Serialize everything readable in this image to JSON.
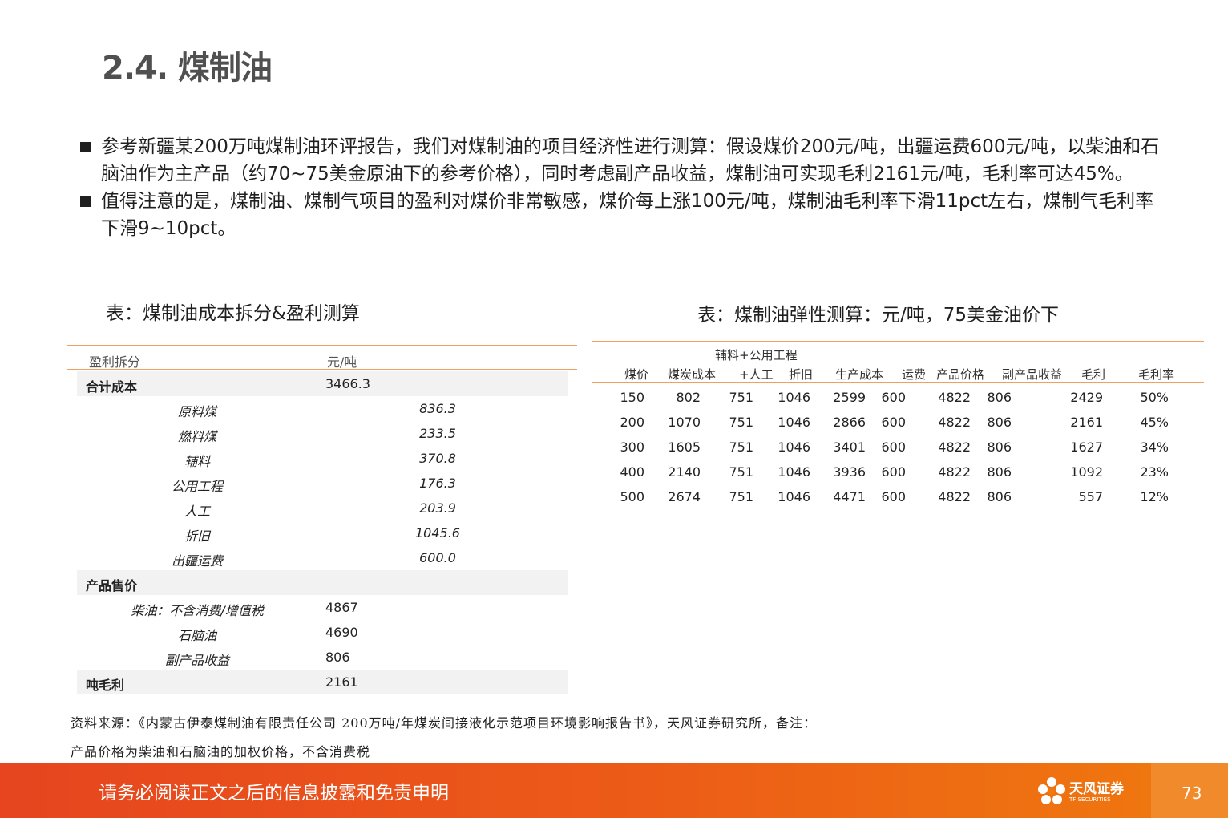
{
  "title": "2.4. 煤制油",
  "bullets": [
    "参考新疆某200万吨煤制油环评报告，我们对煤制油的项目经济性进行测算：假设煤价200元/吨，出疆运费600元/吨，以柴油和石脑油作为主产品（约70~75美金原油下的参考价格），同时考虑副产品收益，煤制油可实现毛利2161元/吨，毛利率可达45%。",
    "值得注意的是，煤制油、煤制气项目的盈利对煤价非常敏感，煤价每上涨100元/吨，煤制油毛利率下滑11pct左右，煤制气毛利率下滑9~10pct。"
  ],
  "left_table": {
    "caption": "表：煤制油成本拆分&盈利测算",
    "header": [
      "盈利拆分",
      "元/吨"
    ],
    "rows": [
      {
        "label": "合计成本",
        "value": "3466.3",
        "type": "section"
      },
      {
        "label": "原料煤",
        "value": "836.3",
        "type": "sub"
      },
      {
        "label": "燃料煤",
        "value": "233.5",
        "type": "sub"
      },
      {
        "label": "辅料",
        "value": "370.8",
        "type": "sub"
      },
      {
        "label": "公用工程",
        "value": "176.3",
        "type": "sub"
      },
      {
        "label": "人工",
        "value": "203.9",
        "type": "sub"
      },
      {
        "label": "折旧",
        "value": "1045.6",
        "type": "sub"
      },
      {
        "label": "出疆运费",
        "value": "600.0",
        "type": "sub"
      },
      {
        "label": "产品售价",
        "value": "",
        "type": "section"
      },
      {
        "label": "柴油：不含消费/增值税",
        "value": "4867",
        "type": "sub2"
      },
      {
        "label": "石脑油",
        "value": "4690",
        "type": "sub2"
      },
      {
        "label": "副产品收益",
        "value": "806",
        "type": "sub2"
      },
      {
        "label": "吨毛利",
        "value": "2161",
        "type": "section"
      }
    ]
  },
  "right_table": {
    "caption": "表：煤制油弹性测算：元/吨，75美金油价下",
    "header_top": "辅料+公用工程",
    "header": [
      "煤价",
      "煤炭成本",
      "+人工",
      "折旧",
      "生产成本",
      "运费",
      "产品价格",
      "副产品收益",
      "毛利",
      "毛利率"
    ],
    "rows": [
      [
        "150",
        "802",
        "751",
        "1046",
        "2599",
        "600",
        "4822",
        "806",
        "2429",
        "50%"
      ],
      [
        "200",
        "1070",
        "751",
        "1046",
        "2866",
        "600",
        "4822",
        "806",
        "2161",
        "45%"
      ],
      [
        "300",
        "1605",
        "751",
        "1046",
        "3401",
        "600",
        "4822",
        "806",
        "1627",
        "34%"
      ],
      [
        "400",
        "2140",
        "751",
        "1046",
        "3936",
        "600",
        "4822",
        "806",
        "1092",
        "23%"
      ],
      [
        "500",
        "2674",
        "751",
        "1046",
        "4471",
        "600",
        "4822",
        "806",
        "557",
        "12%"
      ]
    ]
  },
  "source": [
    "资料来源：《内蒙古伊泰煤制油有限责任公司 200万吨/年煤炭间接液化示范项目环境影响报告书》，天风证券研究所，备注：",
    "产品价格为柴油和石脑油的加权价格，不含消费税"
  ],
  "footer": {
    "disclaimer": "请务必阅读正文之后的信息披露和免责申明",
    "logo_text": "天风证券",
    "logo_sub": "TF SECURITIES",
    "page_number": "73"
  },
  "colors": {
    "accent": "#e6451f",
    "rule": "#f0a060"
  }
}
